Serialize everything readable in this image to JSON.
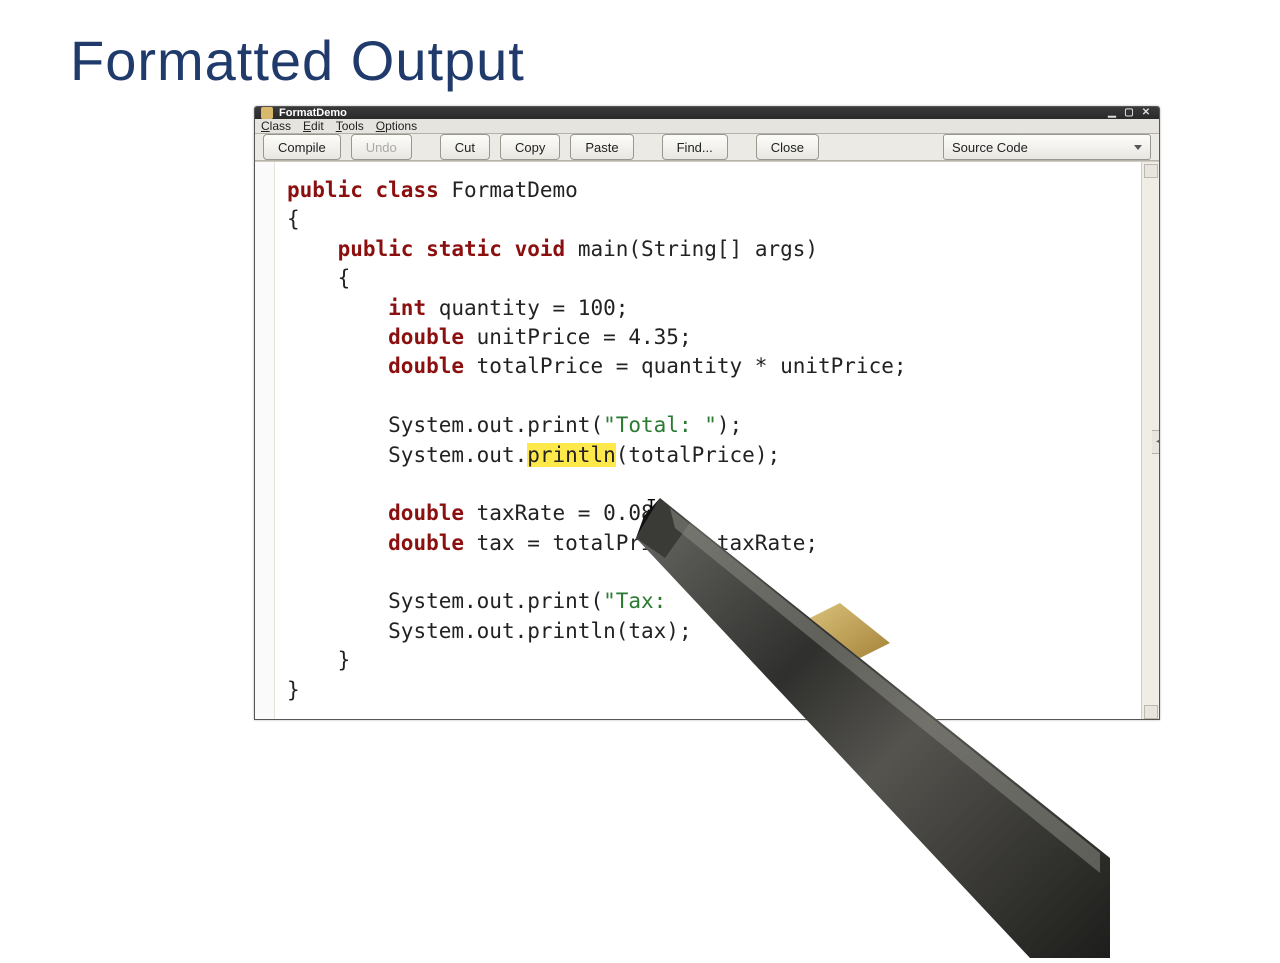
{
  "slide": {
    "title": "Formatted Output"
  },
  "window": {
    "title": "FormatDemo"
  },
  "menubar": {
    "items": [
      "Class",
      "Edit",
      "Tools",
      "Options"
    ]
  },
  "toolbar": {
    "compile": "Compile",
    "undo": "Undo",
    "cut": "Cut",
    "copy": "Copy",
    "paste": "Paste",
    "find": "Find...",
    "close": "Close",
    "view": "Source Code"
  },
  "code": {
    "class_decl_kw1": "public",
    "class_decl_kw2": "class",
    "class_name": "FormatDemo",
    "brace_open": "{",
    "main_kw1": "public",
    "main_kw2": "static",
    "main_kw3": "void",
    "main_sig_rest": " main(String[] args)",
    "main_brace_open": "{",
    "l1_kw": "int",
    "l1_rest": " quantity = 100;",
    "l2_kw": "double",
    "l2_rest": " unitPrice = 4.35;",
    "l3_kw": "double",
    "l3_rest": " totalPrice = quantity * unitPrice;",
    "l4_pre": "System.out.print(",
    "l4_str": "\"Total: \"",
    "l4_post": ");",
    "l5_pre": "System.out.",
    "l5_hl": "println",
    "l5_post": "(totalPrice);",
    "l6_kw": "double",
    "l6_rest": " taxRate = 0.08;",
    "l7_kw": "double",
    "l7_rest": " tax = totalPrice * taxRate;",
    "l8_pre": "System.out.print(",
    "l8_str": "\"Tax:   \"",
    "l8_post": ");",
    "l9": "System.out.println(tax);",
    "main_brace_close": "}",
    "class_brace_close": "}"
  }
}
